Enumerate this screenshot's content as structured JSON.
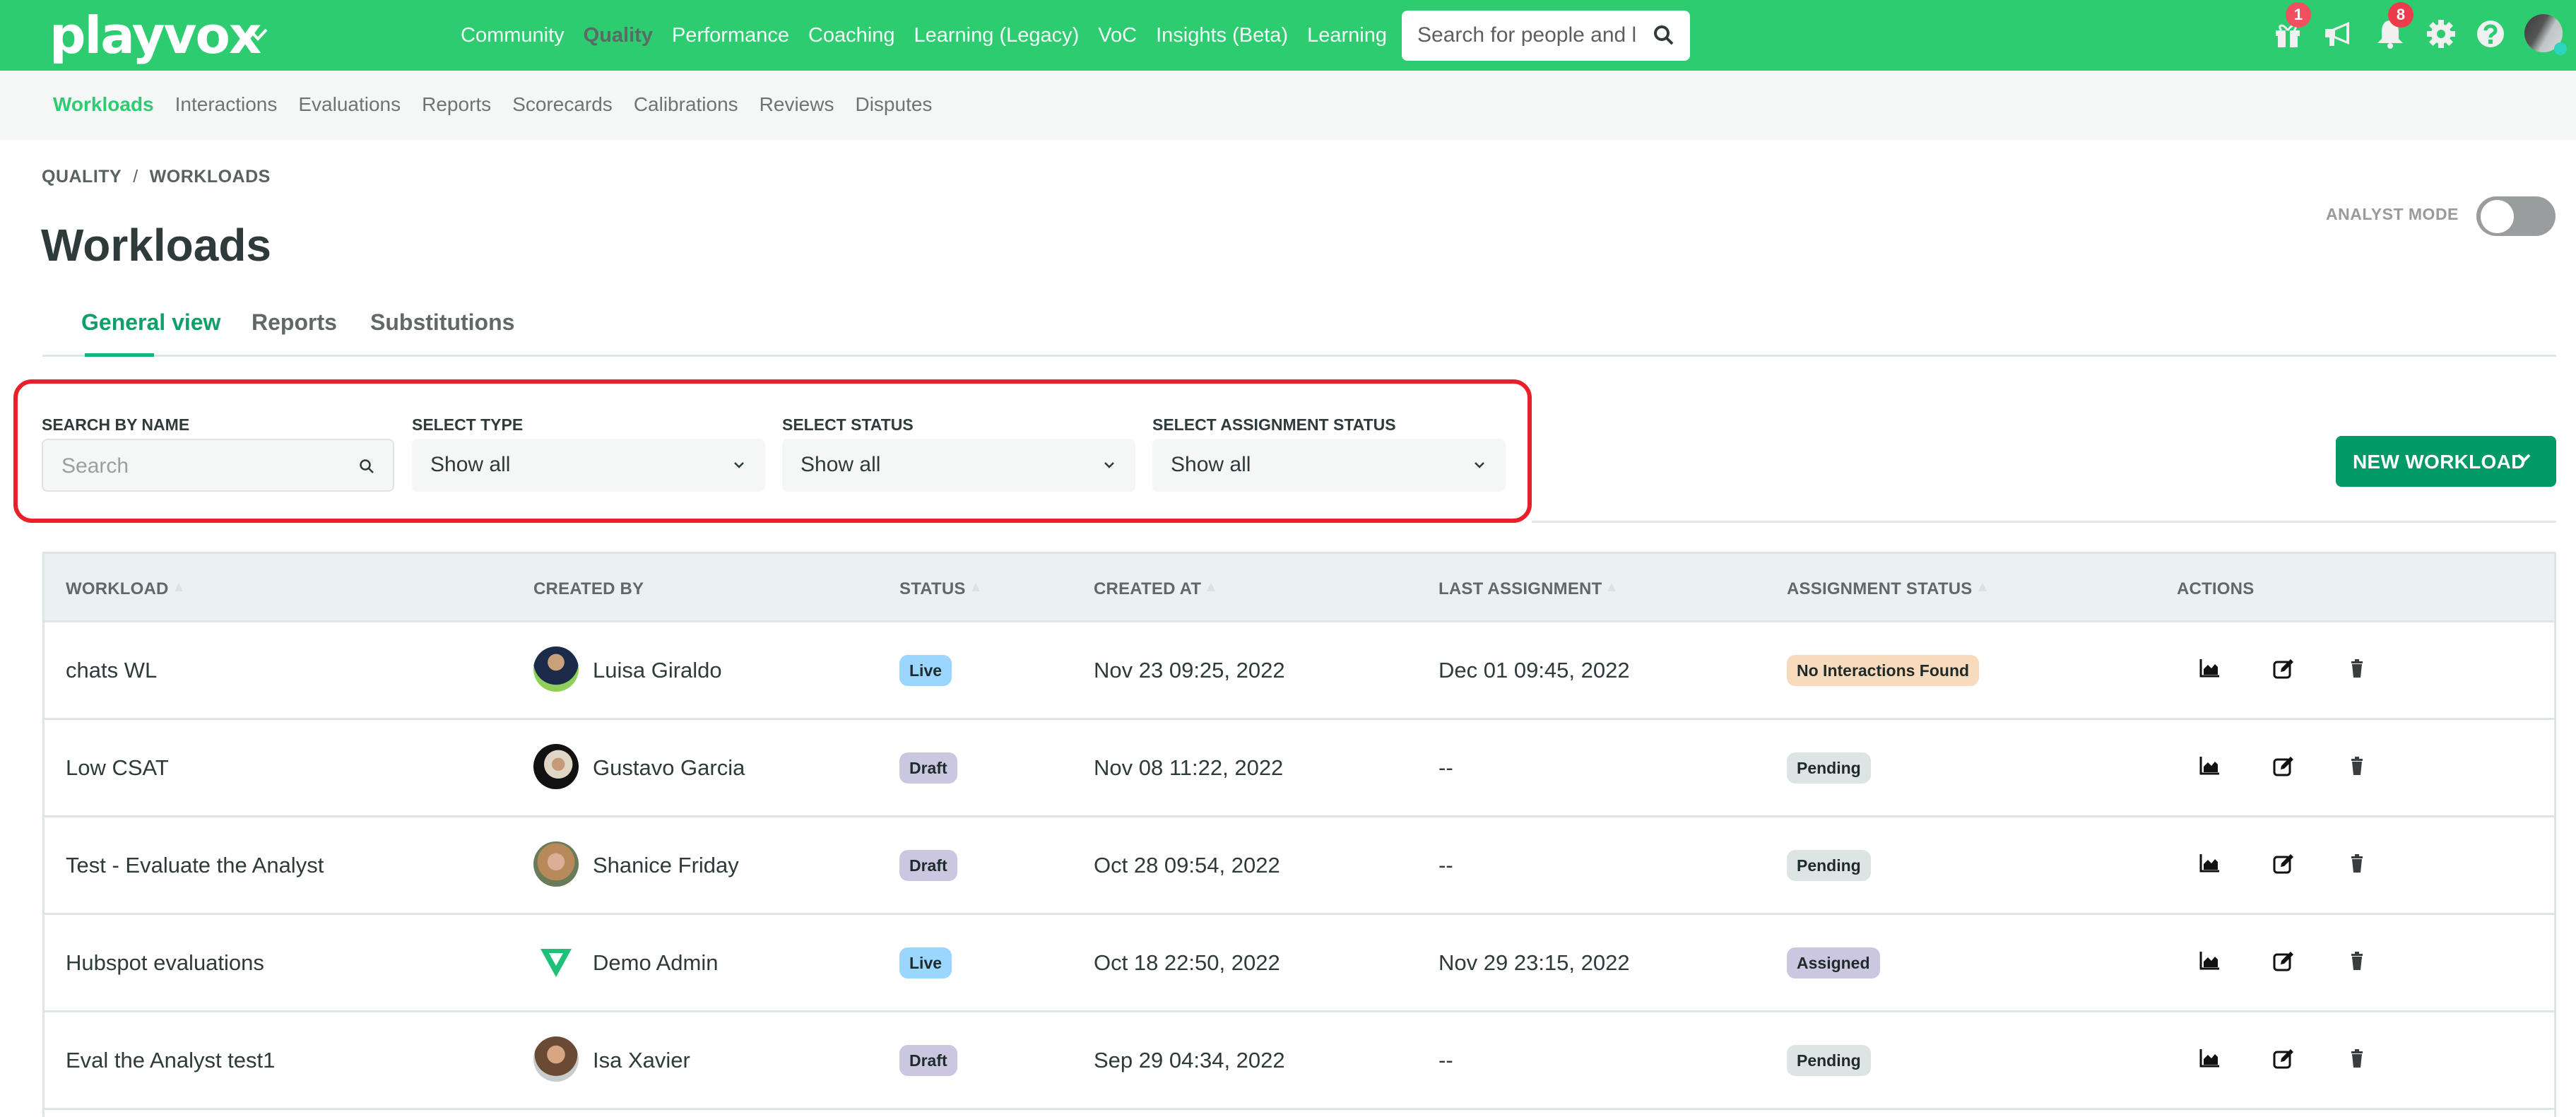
{
  "app": {
    "logo": "playvox",
    "brand_color": "#2ecc71",
    "main_nav": [
      {
        "label": "Community",
        "active": false
      },
      {
        "label": "Quality",
        "active": true
      },
      {
        "label": "Performance",
        "active": false
      },
      {
        "label": "Coaching",
        "active": false
      },
      {
        "label": "Learning (Legacy)",
        "active": false
      },
      {
        "label": "VoC",
        "active": false
      },
      {
        "label": "Insights (Beta)",
        "active": false
      },
      {
        "label": "Learning",
        "active": false
      }
    ],
    "global_search_placeholder": "Search for people and l",
    "icons": {
      "gift_badge": "1",
      "notifications_badge": "8"
    }
  },
  "subnav": [
    {
      "label": "Workloads",
      "active": true
    },
    {
      "label": "Interactions",
      "active": false
    },
    {
      "label": "Evaluations",
      "active": false
    },
    {
      "label": "Reports",
      "active": false
    },
    {
      "label": "Scorecards",
      "active": false
    },
    {
      "label": "Calibrations",
      "active": false
    },
    {
      "label": "Reviews",
      "active": false
    },
    {
      "label": "Disputes",
      "active": false
    }
  ],
  "breadcrumb": [
    "QUALITY",
    "WORKLOADS"
  ],
  "breadcrumb_separator": "/",
  "page_title": "Workloads",
  "analyst_mode": {
    "label": "ANALYST MODE",
    "enabled": false
  },
  "tabs": [
    {
      "label": "General view",
      "active": true
    },
    {
      "label": "Reports",
      "active": false
    },
    {
      "label": "Substitutions",
      "active": false
    }
  ],
  "filters": {
    "search": {
      "label": "SEARCH BY NAME",
      "placeholder": "Search",
      "value": ""
    },
    "type": {
      "label": "SELECT TYPE",
      "value": "Show all"
    },
    "status": {
      "label": "SELECT STATUS",
      "value": "Show all"
    },
    "assignment_status": {
      "label": "SELECT ASSIGNMENT STATUS",
      "value": "Show all"
    }
  },
  "new_workload_button": "NEW WORKLOAD",
  "table": {
    "columns": [
      "WORKLOAD",
      "CREATED BY",
      "STATUS",
      "CREATED AT",
      "LAST ASSIGNMENT",
      "ASSIGNMENT STATUS",
      "ACTIONS"
    ],
    "rows": [
      {
        "workload": "chats WL",
        "created_by": "Luisa Giraldo",
        "status": "Live",
        "created_at": "Nov 23 09:25, 2022",
        "last_assignment": "Dec 01 09:45, 2022",
        "assignment_status": "No Interactions Found"
      },
      {
        "workload": "Low CSAT",
        "created_by": "Gustavo Garcia",
        "status": "Draft",
        "created_at": "Nov 08 11:22, 2022",
        "last_assignment": "--",
        "assignment_status": "Pending"
      },
      {
        "workload": "Test - Evaluate the Analyst",
        "created_by": "Shanice Friday",
        "status": "Draft",
        "created_at": "Oct 28 09:54, 2022",
        "last_assignment": "--",
        "assignment_status": "Pending"
      },
      {
        "workload": "Hubspot evaluations",
        "created_by": "Demo Admin",
        "status": "Live",
        "created_at": "Oct 18 22:50, 2022",
        "last_assignment": "Nov 29 23:15, 2022",
        "assignment_status": "Assigned"
      },
      {
        "workload": "Eval the Analyst test1",
        "created_by": "Isa Xavier",
        "status": "Draft",
        "created_at": "Sep 29 04:34, 2022",
        "last_assignment": "--",
        "assignment_status": "Pending"
      }
    ]
  }
}
